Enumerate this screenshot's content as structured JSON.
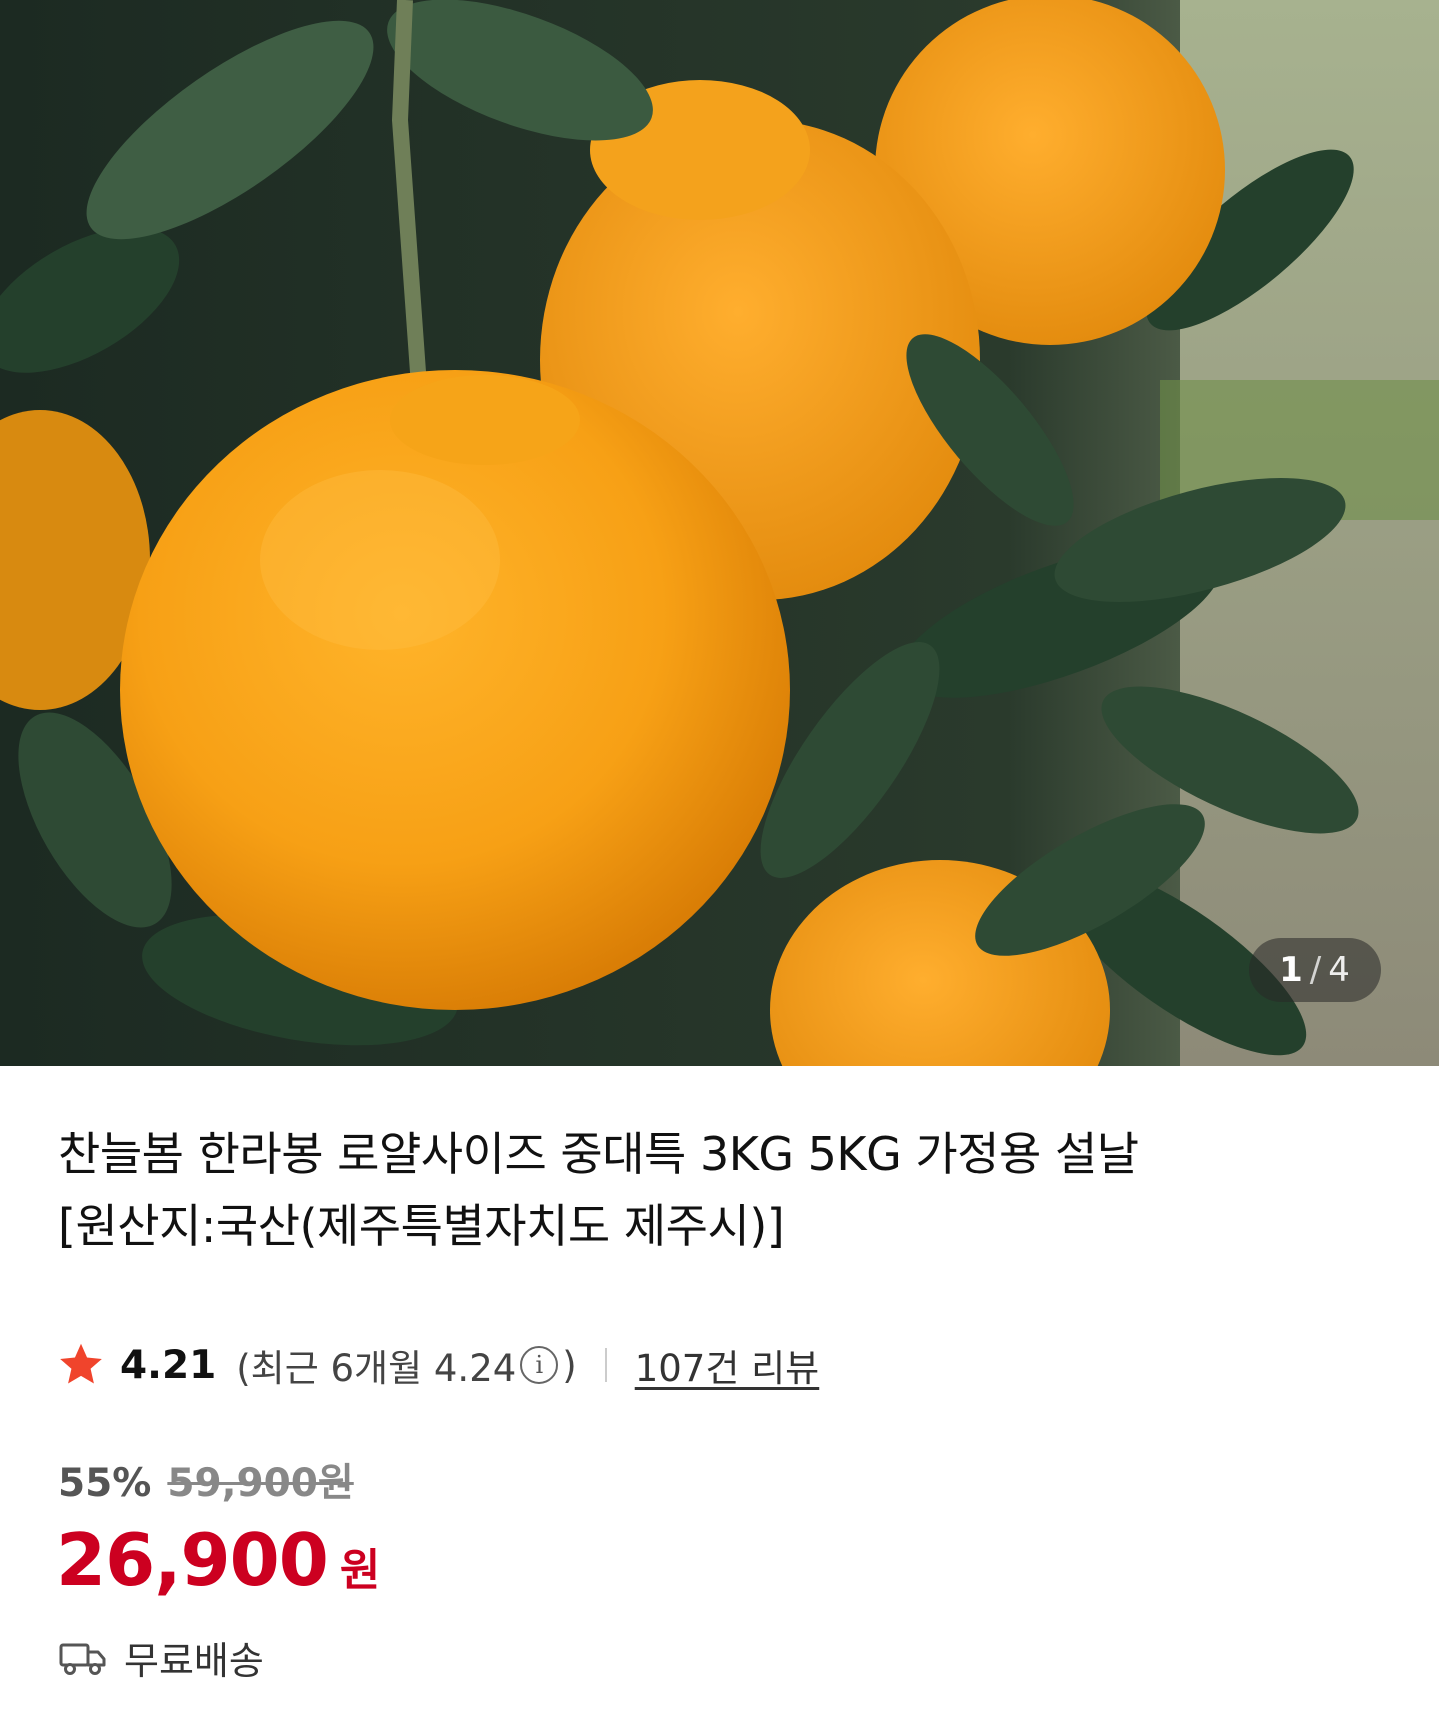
{
  "gallery": {
    "current": "1",
    "separator": "/",
    "total": "4"
  },
  "product": {
    "title_line1": "찬늘봄 한라봉 로얄사이즈 중대특 3KG 5KG 가정용 설날",
    "title_line2": "[원산지:국산(제주특별자치도 제주시)]"
  },
  "rating": {
    "score": "4.21",
    "recent_prefix": "(최근 6개월 4.24",
    "recent_suffix": ")",
    "info_symbol": "i",
    "review_count": "107건 리뷰"
  },
  "price": {
    "discount_rate": "55%",
    "original": "59,900원",
    "sale": "26,900",
    "unit": "원"
  },
  "shipping": {
    "label": "무료배송"
  },
  "colors": {
    "sale_price": "#cc0020",
    "star": "#f0442c"
  },
  "icons": {
    "star": "star-icon",
    "info": "info-icon",
    "truck": "truck-icon"
  }
}
